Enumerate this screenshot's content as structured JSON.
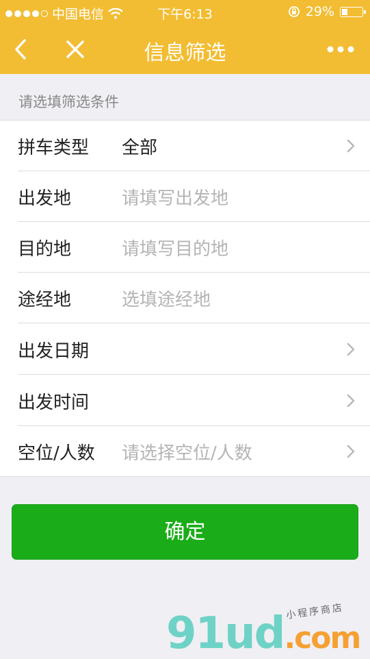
{
  "status_bar": {
    "carrier": "中国电信",
    "time": "下午6:13",
    "battery": "29%",
    "battery_level": 0.29
  },
  "nav": {
    "title": "信息筛选"
  },
  "form": {
    "hint": "请选填筛选条件",
    "rows": [
      {
        "label": "拼车类型",
        "value": "全部",
        "placeholder": ""
      },
      {
        "label": "出发地",
        "value": "",
        "placeholder": "请填写出发地"
      },
      {
        "label": "目的地",
        "value": "",
        "placeholder": "请填写目的地"
      },
      {
        "label": "途经地",
        "value": "",
        "placeholder": "选填途经地"
      },
      {
        "label": "出发日期",
        "value": "",
        "placeholder": ""
      },
      {
        "label": "出发时间",
        "value": "",
        "placeholder": ""
      },
      {
        "label": "空位/人数",
        "value": "",
        "placeholder": "请选择空位/人数"
      }
    ]
  },
  "actions": {
    "confirm_label": "确定"
  },
  "watermark": {
    "brand_a": "91ud",
    "brand_b": ".com",
    "tagline": "小程序商店"
  }
}
